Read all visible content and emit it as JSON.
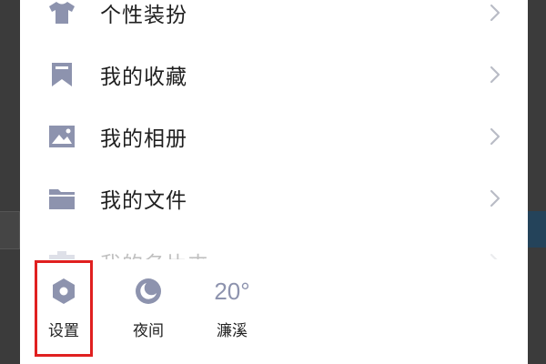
{
  "colors": {
    "icon": "#8d93ae",
    "chevron": "#b9bcc6",
    "text": "#1f1f1f",
    "highlight": "#e02020"
  },
  "menu": {
    "items": [
      {
        "label": "个性装扮",
        "icon": "tshirt-icon"
      },
      {
        "label": "我的收藏",
        "icon": "bookmark-icon"
      },
      {
        "label": "我的相册",
        "icon": "image-icon"
      },
      {
        "label": "我的文件",
        "icon": "folder-icon"
      },
      {
        "label": "我的名片夹",
        "icon": "card-holder-icon"
      }
    ]
  },
  "bottom_bar": {
    "settings_label": "设置",
    "night_label": "夜间",
    "weather_temp": "20°",
    "weather_city": "濂溪"
  }
}
